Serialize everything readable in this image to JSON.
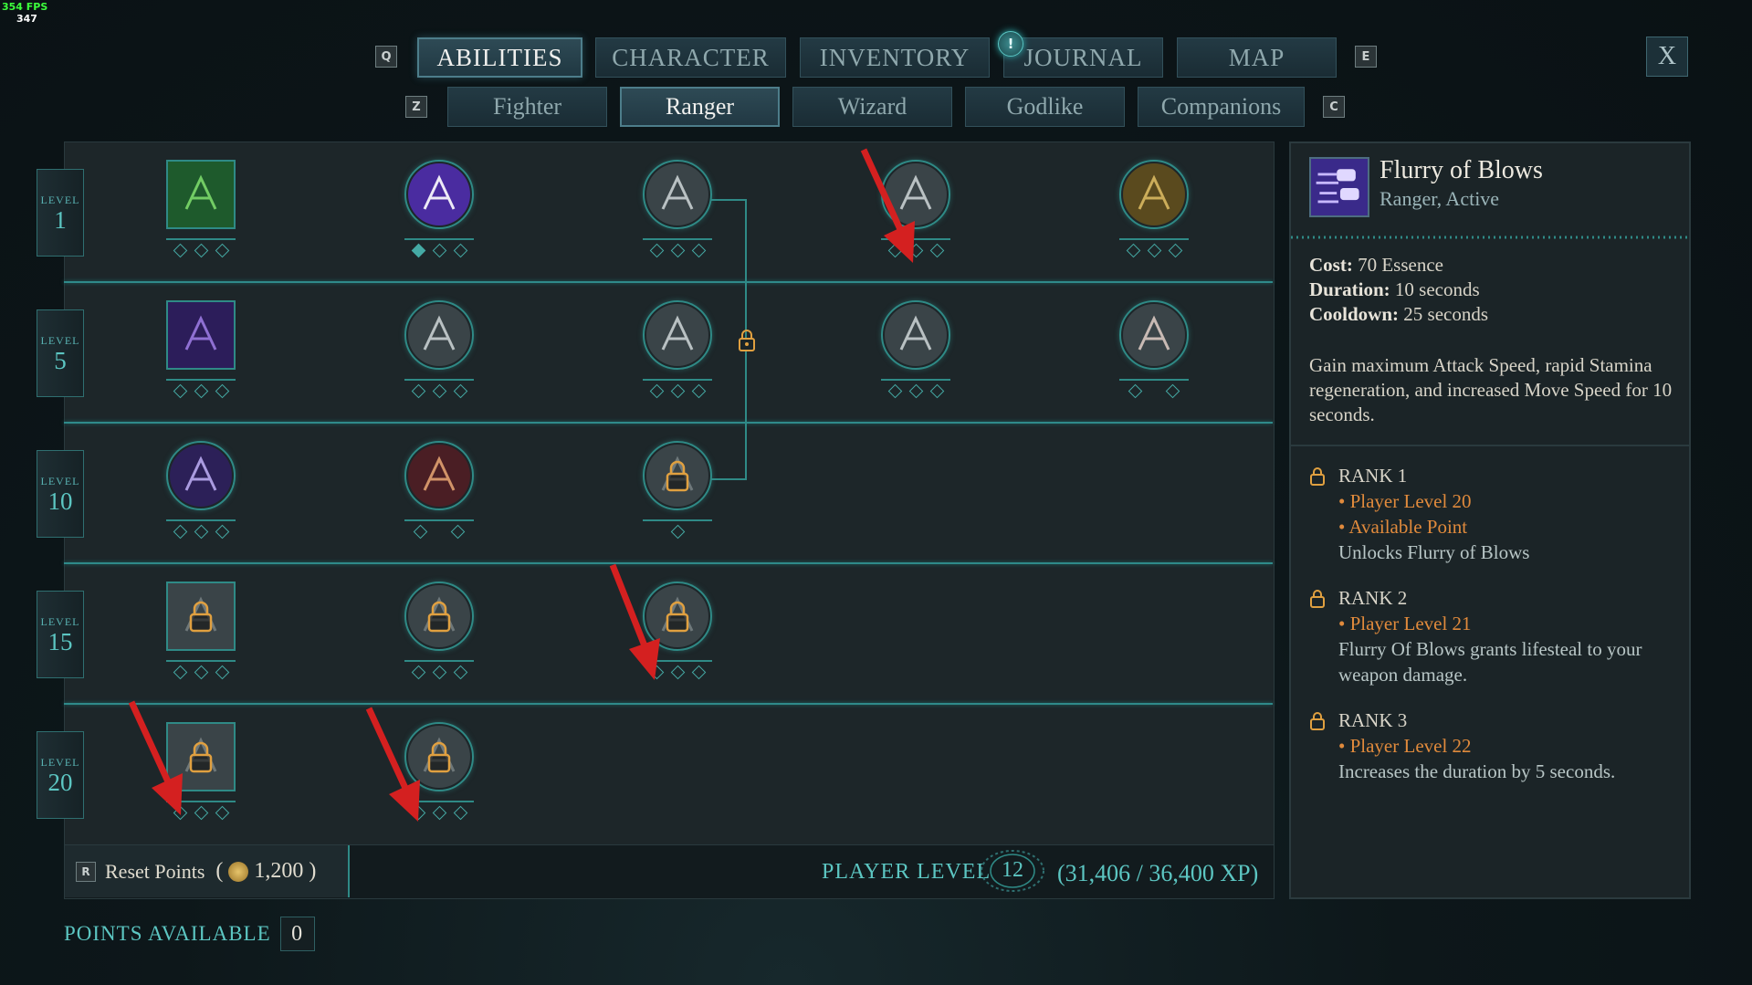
{
  "fps": {
    "fps_label": "354 FPS",
    "frame": "347"
  },
  "nav": {
    "left_key": "Q",
    "right_key": "E",
    "tabs": [
      {
        "label": "ABILITIES",
        "active": true
      },
      {
        "label": "CHARACTER",
        "active": false
      },
      {
        "label": "INVENTORY",
        "active": false
      },
      {
        "label": "JOURNAL",
        "active": false,
        "notification": "!"
      },
      {
        "label": "MAP",
        "active": false
      }
    ],
    "close_label": "X"
  },
  "subnav": {
    "left_key": "Z",
    "right_key": "C",
    "tabs": [
      {
        "label": "Fighter",
        "active": false
      },
      {
        "label": "Ranger",
        "active": true
      },
      {
        "label": "Wizard",
        "active": false
      },
      {
        "label": "Godlike",
        "active": false
      },
      {
        "label": "Companions",
        "active": false
      }
    ]
  },
  "tree": {
    "level_word": "LEVEL",
    "levels": [
      "1",
      "5",
      "10",
      "15",
      "20"
    ],
    "nodes": [
      {
        "row": 0,
        "col": 0,
        "shape": "square",
        "icon": "green-vine-icon",
        "ranks": 3,
        "filled": 0,
        "locked": false
      },
      {
        "row": 0,
        "col": 1,
        "shape": "circle",
        "icon": "purple-bubbles-icon",
        "ranks": 3,
        "filled": 1,
        "locked": false
      },
      {
        "row": 0,
        "col": 2,
        "shape": "circle",
        "icon": "arrow-burst-icon",
        "ranks": 3,
        "filled": 0,
        "locked": false
      },
      {
        "row": 0,
        "col": 3,
        "shape": "circle",
        "icon": "crossed-blades-icon",
        "ranks": 3,
        "filled": 0,
        "locked": false
      },
      {
        "row": 0,
        "col": 4,
        "shape": "circle",
        "icon": "golden-wing-icon",
        "ranks": 3,
        "filled": 0,
        "locked": false
      },
      {
        "row": 1,
        "col": 0,
        "shape": "square",
        "icon": "running-figure-icon",
        "ranks": 3,
        "filled": 0,
        "locked": false
      },
      {
        "row": 1,
        "col": 1,
        "shape": "circle",
        "icon": "star-dagger-icon",
        "ranks": 3,
        "filled": 0,
        "locked": false
      },
      {
        "row": 1,
        "col": 2,
        "shape": "circle",
        "icon": "twin-weapons-icon",
        "ranks": 3,
        "filled": 0,
        "locked": false
      },
      {
        "row": 1,
        "col": 3,
        "shape": "circle",
        "icon": "crossed-swords-icon",
        "ranks": 3,
        "filled": 0,
        "locked": false
      },
      {
        "row": 1,
        "col": 4,
        "shape": "circle",
        "icon": "grabbing-hand-icon",
        "ranks": 2,
        "filled": 0,
        "locked": false
      },
      {
        "row": 2,
        "col": 0,
        "shape": "circle",
        "icon": "purple-dash-icon",
        "ranks": 3,
        "filled": 0,
        "locked": false
      },
      {
        "row": 2,
        "col": 1,
        "shape": "circle",
        "icon": "red-arrows-icon",
        "ranks": 2,
        "filled": 0,
        "locked": false
      },
      {
        "row": 2,
        "col": 2,
        "shape": "circle",
        "icon": "locked-gear-icon",
        "ranks": 1,
        "filled": 0,
        "locked": true
      },
      {
        "row": 3,
        "col": 0,
        "shape": "square",
        "icon": "locked-crest-icon",
        "ranks": 3,
        "filled": 0,
        "locked": true
      },
      {
        "row": 3,
        "col": 1,
        "shape": "circle",
        "icon": "locked-chevron-icon",
        "ranks": 3,
        "filled": 0,
        "locked": true
      },
      {
        "row": 3,
        "col": 2,
        "shape": "circle",
        "icon": "locked-shield-icon",
        "ranks": 3,
        "filled": 0,
        "locked": true
      },
      {
        "row": 4,
        "col": 0,
        "shape": "square",
        "icon": "locked-fist-icon",
        "ranks": 3,
        "filled": 0,
        "locked": true
      },
      {
        "row": 4,
        "col": 1,
        "shape": "circle",
        "icon": "locked-compass-icon",
        "ranks": 3,
        "filled": 0,
        "locked": true
      }
    ]
  },
  "footer": {
    "reset_key": "R",
    "reset_label": "Reset Points",
    "reset_cost": "1,200",
    "player_level_label": "PLAYER LEVEL",
    "player_level": "12",
    "xp": "(31,406 / 36,400 XP)",
    "points_label": "POINTS AVAILABLE",
    "points_value": "0"
  },
  "detail": {
    "icon": "flurry-fists-icon",
    "title": "Flurry of Blows",
    "subtitle": "Ranger, Active",
    "cost_label": "Cost:",
    "cost": "70 Essence",
    "duration_label": "Duration:",
    "duration": "10 seconds",
    "cooldown_label": "Cooldown:",
    "cooldown": "25 seconds",
    "description": "Gain maximum Attack Speed, rapid Stamina regeneration, and increased Move Speed for 10 seconds.",
    "ranks": [
      {
        "title": "RANK 1",
        "reqs": [
          "• Player Level 20",
          "• Available Point"
        ],
        "text": "Unlocks Flurry of Blows"
      },
      {
        "title": "RANK 2",
        "reqs": [
          "• Player Level 21"
        ],
        "text": "Flurry Of Blows grants lifesteal to your weapon damage."
      },
      {
        "title": "RANK 3",
        "reqs": [
          "• Player Level 22"
        ],
        "text": "Increases the duration by 5 seconds."
      }
    ]
  },
  "colors": {
    "teal": "#45aaa5",
    "orange": "#e08a3c",
    "arrow_red": "#d42020"
  }
}
